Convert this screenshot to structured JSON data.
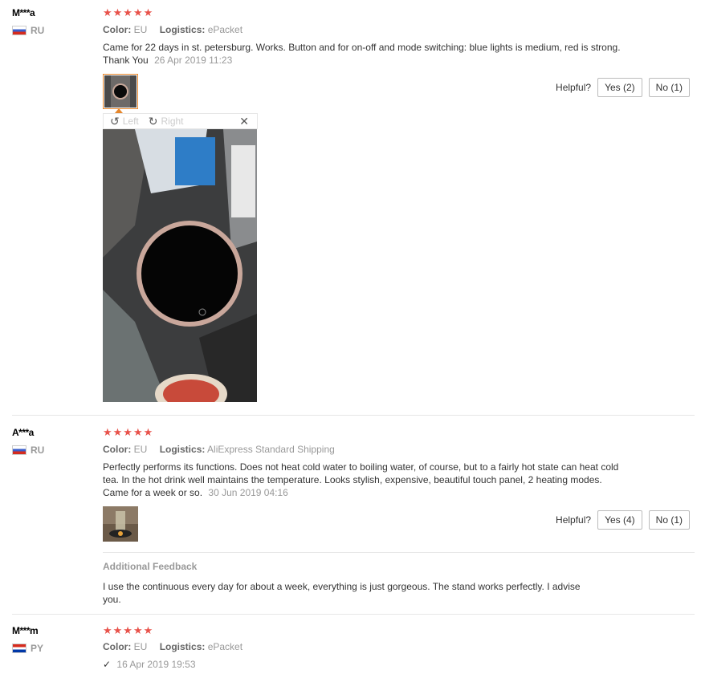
{
  "reviews": [
    {
      "user": "M***a",
      "country": "RU",
      "flag": "flag-ru",
      "stars": "★★★★★",
      "color_label": "Color:",
      "color_value": "EU",
      "logistics_label": "Logistics:",
      "logistics_value": "ePacket",
      "text": "Came for 22 days in st. petersburg. Works. Button and for on-off and mode switching: blue lights is medium, red is strong. Thank You",
      "date": "26 Apr 2019 11:23",
      "helpful_label": "Helpful?",
      "yes_label": "Yes (2)",
      "no_label": "No (1)"
    },
    {
      "user": "A***a",
      "country": "RU",
      "flag": "flag-ru",
      "stars": "★★★★★",
      "color_label": "Color:",
      "color_value": "EU",
      "logistics_label": "Logistics:",
      "logistics_value": "AliExpress Standard Shipping",
      "text": "Perfectly performs its functions. Does not heat cold water to boiling water, of course, but to a fairly hot state can heat cold tea. In the hot drink well maintains the temperature. Looks stylish, expensive, beautiful touch panel, 2 heating modes. Came for a week or so.",
      "date": "30 Jun 2019 04:16",
      "helpful_label": "Helpful?",
      "yes_label": "Yes (4)",
      "no_label": "No (1)",
      "additional_title": "Additional Feedback",
      "additional_text": "I use the continuous every day for about a week, everything is just gorgeous. The stand works perfectly. I advise you."
    },
    {
      "user": "M***m",
      "country": "PY",
      "flag": "flag-py",
      "stars": "★★★★★",
      "color_label": "Color:",
      "color_value": "EU",
      "logistics_label": "Logistics:",
      "logistics_value": "ePacket",
      "check": "✓",
      "date": "16 Apr 2019 19:53"
    }
  ],
  "viewer": {
    "left_label": "Left",
    "right_label": "Right",
    "left_icon": "rotate-left-icon",
    "right_icon": "rotate-right-icon",
    "close_icon": "close-icon",
    "close_glyph": "✕",
    "left_glyph": "↺",
    "right_glyph": "↻"
  },
  "colors": {
    "star": "#e8524a",
    "accent_border": "#e6862b",
    "muted": "#999999"
  }
}
